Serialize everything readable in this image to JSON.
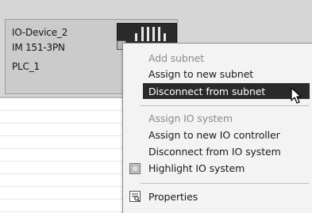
{
  "device": {
    "name": "IO-Device_2",
    "module": "IM 151-3PN",
    "controller": "PLC_1"
  },
  "menu": {
    "items": [
      {
        "label": "Add subnet",
        "state": "disabled"
      },
      {
        "label": "Assign to new subnet",
        "state": "enabled"
      },
      {
        "label": "Disconnect from subnet",
        "state": "highlighted"
      },
      {
        "label": "Assign IO system",
        "state": "disabled"
      },
      {
        "label": "Assign to new IO controller",
        "state": "enabled"
      },
      {
        "label": "Disconnect from IO system",
        "state": "enabled"
      },
      {
        "label": "Highlight IO system",
        "state": "enabled",
        "icon": "highlight-square-icon"
      },
      {
        "label": "Properties",
        "state": "enabled",
        "icon": "properties-icon"
      }
    ]
  },
  "colors": {
    "highlight": "#2a2a2a",
    "canvas": "#d6d6d6",
    "menu_bg": "#f3f3f3"
  }
}
